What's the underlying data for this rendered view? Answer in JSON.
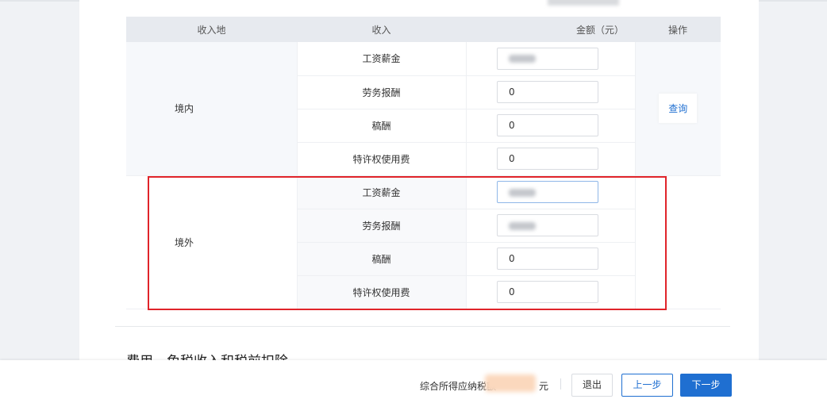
{
  "page": {
    "section_title": "费用、免税收入和税前扣除"
  },
  "table": {
    "headers": {
      "region": "收入地",
      "income": "收入",
      "amount": "金额（元）",
      "ops": "操作"
    },
    "domestic": {
      "region": "境内",
      "query_label": "查询",
      "rows": [
        {
          "item": "工资薪金",
          "value": ""
        },
        {
          "item": "劳务报酬",
          "value": "0"
        },
        {
          "item": "稿酬",
          "value": "0"
        },
        {
          "item": "特许权使用费",
          "value": "0"
        }
      ]
    },
    "foreign": {
      "region": "境外",
      "rows": [
        {
          "item": "工资薪金",
          "value": ""
        },
        {
          "item": "劳务报酬",
          "value": ""
        },
        {
          "item": "稿酬",
          "value": "0"
        },
        {
          "item": "特许权使用费",
          "value": "0"
        }
      ]
    }
  },
  "footer": {
    "tax_label": "综合所得应纳税额",
    "unit": "元",
    "exit_label": "退出",
    "prev_label": "上一步",
    "next_label": "下一步"
  },
  "colors": {
    "primary": "#1f6fd1",
    "highlight": "#e0242a",
    "header_bg": "#e7eaef"
  }
}
